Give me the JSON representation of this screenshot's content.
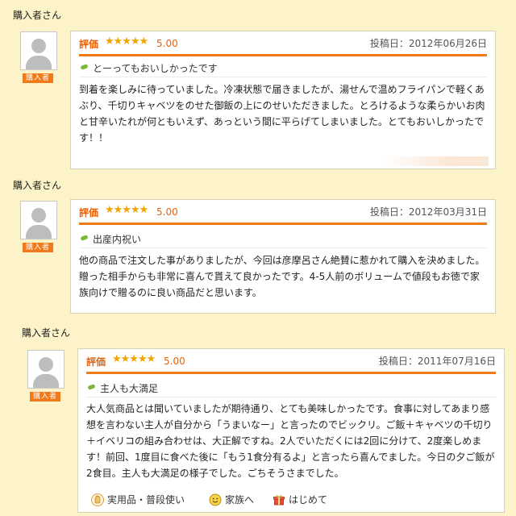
{
  "reviews": [
    {
      "reviewer": "購入者さん",
      "badge": "購入者",
      "rating_label": "評価",
      "stars": "★★★★★",
      "score": "5.00",
      "date": "投稿日：2012年06月26日",
      "title": "とーってもおいしかったです",
      "body": "到着を楽しみに待っていました。冷凍状態で届きましたが、湯せんで温めフライパンで軽くあぶり、千切りキャベツをのせた御飯の上にのせいただきました。とろけるような柔らかいお肉と甘辛いたれが何ともいえず、あっという間に平らげてしまいました。とてもおいしかったです！！"
    },
    {
      "reviewer": "購入者さん",
      "badge": "購入者",
      "rating_label": "評価",
      "stars": "★★★★★",
      "score": "5.00",
      "date": "投稿日：2012年03月31日",
      "title": "出産内祝い",
      "body": "他の商品で注文した事がありましたが、今回は彦摩呂さん絶賛に惹かれて購入を決めました。贈った相手からも非常に喜んで貰えて良かったです。4-5人前のボリュームで値段もお徳で家族向けで贈るのに良い商品だと思います。"
    },
    {
      "reviewer": "購入者さん",
      "badge": "購入者",
      "rating_label": "評価",
      "stars": "★★★★★",
      "score": "5.00",
      "date": "投稿日：2011年07月16日",
      "title": "主人も大満足",
      "body": "大人気商品とは聞いていましたが期待通り、とても美味しかったです。食事に対してあまり感想を言わない主人が自分から「うまいなー」と言ったのでビックリ。ご飯＋キャベツの千切り＋イベリコの組み合わせは、大正解ですね。2人でいただくには2回に分けて、2度楽しめます！前回、1度目に食べた後に「もう1食分有るよ」と言ったら喜んでました。今日の夕ご飯が2食目。主人も大満足の様子でした。ごちそうさまでした。",
      "tags": [
        {
          "label": "実用品・普段使い",
          "icon": "hand-icon"
        },
        {
          "label": "家族へ",
          "icon": "smiley-icon"
        },
        {
          "label": "はじめて",
          "icon": "gift-icon"
        }
      ]
    }
  ],
  "colors": {
    "accent": "#f07a1a",
    "rating_text": "#e8620c",
    "star": "#f0a500",
    "background": "#fdf3c8"
  }
}
